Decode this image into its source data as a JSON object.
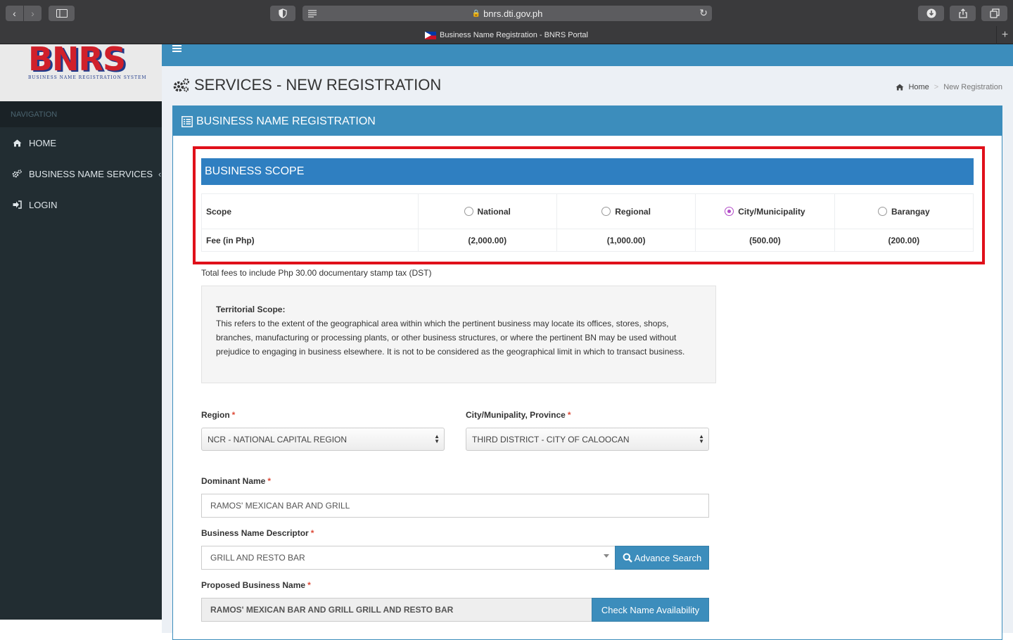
{
  "browser": {
    "url": "bnrs.dti.gov.ph",
    "tab_title": "Business Name Registration - BNRS Portal"
  },
  "sidebar": {
    "logo_text": "BNRS",
    "logo_subtitle": "BUSINESS NAME REGISTRATION SYSTEM",
    "nav_header": "NAVIGATION",
    "items": [
      {
        "label": "HOME",
        "icon": "home-icon"
      },
      {
        "label": "BUSINESS NAME SERVICES",
        "icon": "gears-icon"
      },
      {
        "label": "LOGIN",
        "icon": "sign-in-icon"
      }
    ]
  },
  "page": {
    "title": "SERVICES - NEW REGISTRATION",
    "breadcrumb": {
      "home": "Home",
      "current": "New Registration"
    }
  },
  "box": {
    "title": "BUSINESS NAME REGISTRATION"
  },
  "scope": {
    "title": "BUSINESS SCOPE",
    "scope_label": "Scope",
    "fee_label": "Fee (in Php)",
    "options": [
      {
        "label": "National",
        "fee": "(2,000.00)",
        "selected": false
      },
      {
        "label": "Regional",
        "fee": "(1,000.00)",
        "selected": false
      },
      {
        "label": "City/Municipality",
        "fee": "(500.00)",
        "selected": true
      },
      {
        "label": "Barangay",
        "fee": "(200.00)",
        "selected": false
      }
    ],
    "dst_note": "Total fees to include Php 30.00 documentary stamp tax (DST)"
  },
  "territorial": {
    "heading": "Territorial Scope:",
    "text": "This refers to the extent of the geographical area within which the pertinent business may locate its offices, stores, shops, branches, manufacturing or processing plants, or other business structures, or where the pertinent BN may be used without prejudice to engaging in business elsewhere. It is not to be considered as the geographical limit in which to transact business."
  },
  "form": {
    "region_label": "Region",
    "region_value": "NCR - NATIONAL CAPITAL REGION",
    "city_label": "City/Munipality, Province",
    "city_value": "THIRD DISTRICT - CITY OF CALOOCAN",
    "dominant_label": "Dominant Name",
    "dominant_value": "RAMOS' MEXICAN BAR AND GRILL",
    "descriptor_label": "Business Name Descriptor",
    "descriptor_value": "GRILL AND RESTO BAR",
    "advance_search": "Advance Search",
    "proposed_label": "Proposed Business Name",
    "proposed_value": "RAMOS' MEXICAN BAR AND GRILL GRILL AND RESTO BAR",
    "check_availability": "Check Name Availability",
    "required_mark": "*"
  },
  "colors": {
    "primary": "#3c8dbc",
    "sidebar": "#222d32",
    "highlight": "#e0101a",
    "radio_selected": "#b14cc7"
  }
}
